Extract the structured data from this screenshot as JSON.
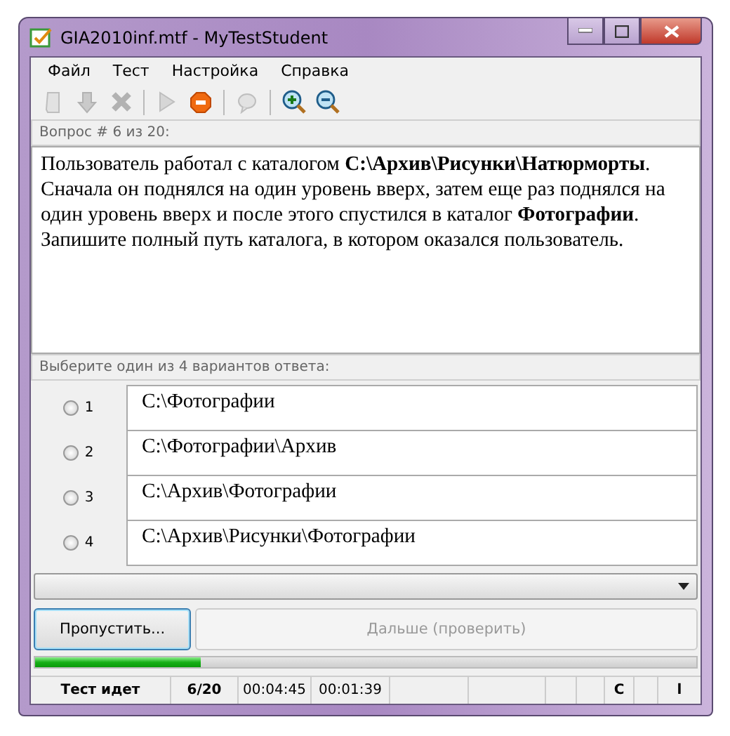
{
  "window": {
    "title": "GIA2010inf.mtf - MyTestStudent"
  },
  "menu": [
    "Файл",
    "Тест",
    "Настройка",
    "Справка"
  ],
  "toolbar": [
    {
      "kind": "book",
      "disabled": true
    },
    {
      "kind": "down",
      "disabled": true
    },
    {
      "kind": "delete",
      "disabled": true
    },
    {
      "kind": "sep"
    },
    {
      "kind": "play",
      "disabled": true
    },
    {
      "kind": "stop",
      "disabled": false
    },
    {
      "kind": "sep"
    },
    {
      "kind": "speech",
      "disabled": true
    },
    {
      "kind": "sep"
    },
    {
      "kind": "zoom-in",
      "disabled": false
    },
    {
      "kind": "zoom-out",
      "disabled": false
    }
  ],
  "question": {
    "header": "Вопрос # 6 из 20:",
    "text": "Пользователь работал с каталогом **C:\\Архив\\Рисунки\\Натюрморты**. Сначала он поднялся на один уровень вверх, затем еще раз поднялся на один уровень вверх и после этого спустился в каталог **Фотографии**. Запишите полный путь каталога, в котором оказался пользователь."
  },
  "answers": {
    "header": "Выберите один из 4 вариантов ответа:",
    "options": [
      {
        "number": "1",
        "text": "C:\\Фотографии",
        "selected": false
      },
      {
        "number": "2",
        "text": "C:\\Фотографии\\Архив",
        "selected": false
      },
      {
        "number": "3",
        "text": "C:\\Архив\\Фотографии",
        "selected": false
      },
      {
        "number": "4",
        "text": "C:\\Архив\\Рисунки\\Фотографии",
        "selected": false
      }
    ]
  },
  "buttons": [
    {
      "label": "Пропустить...",
      "disabled": false
    },
    {
      "label": "Дальше (проверить)",
      "disabled": true
    }
  ],
  "progress": {
    "level": 0.25
  },
  "status_bar": [
    {
      "kind": "text",
      "text": "Тест идет",
      "bold": true
    },
    {
      "kind": "text",
      "text": "6/20",
      "bold": true
    },
    {
      "kind": "text",
      "text": "00:04:45",
      "bold": false
    },
    {
      "kind": "text",
      "text": "00:01:39",
      "bold": false
    },
    {
      "kind": "empty"
    },
    {
      "kind": "empty"
    },
    {
      "kind": "empty"
    },
    {
      "kind": "empty"
    },
    {
      "kind": "text",
      "text": "C",
      "bold": true
    },
    {
      "kind": "empty"
    },
    {
      "kind": "text",
      "text": "l",
      "bold": true
    }
  ]
}
